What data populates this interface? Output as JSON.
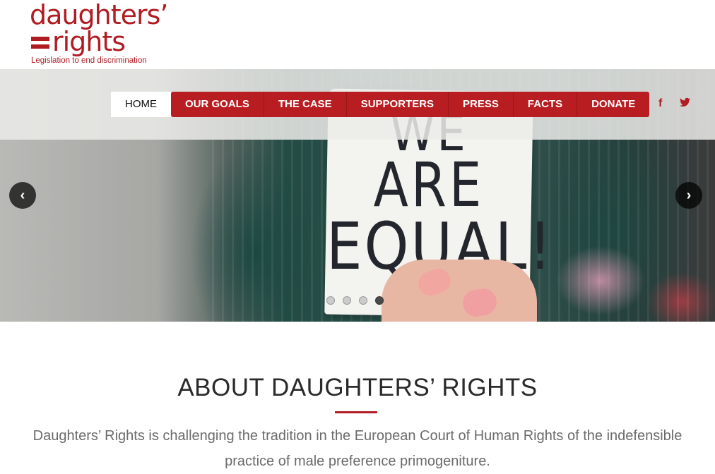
{
  "logo": {
    "line1": "daughters’",
    "line2": "rights",
    "tagline": "Legislation to end discrimination"
  },
  "nav": {
    "items": [
      {
        "label": "HOME",
        "active": true
      },
      {
        "label": "OUR GOALS",
        "active": false
      },
      {
        "label": "THE CASE",
        "active": false
      },
      {
        "label": "SUPPORTERS",
        "active": false
      },
      {
        "label": "PRESS",
        "active": false
      },
      {
        "label": "FACTS",
        "active": false
      },
      {
        "label": "DONATE",
        "active": false
      }
    ],
    "social": [
      {
        "name": "facebook-icon",
        "glyph": "f"
      },
      {
        "name": "twitter-icon",
        "glyph": "🐦"
      }
    ]
  },
  "hero": {
    "sign_lines": [
      "WE",
      "ARE",
      "EQUAL!"
    ],
    "prev_glyph": "‹",
    "next_glyph": "›",
    "slides_count": 4,
    "active_slide": 4
  },
  "about": {
    "title": "ABOUT DAUGHTERS’ RIGHTS",
    "text": "Daughters’ Rights is challenging the tradition in the European Court of Human Rights of the indefensible practice of male preference primogeniture."
  },
  "colors": {
    "brand_red": "#b01c22",
    "nav_red": "#b81d22"
  }
}
